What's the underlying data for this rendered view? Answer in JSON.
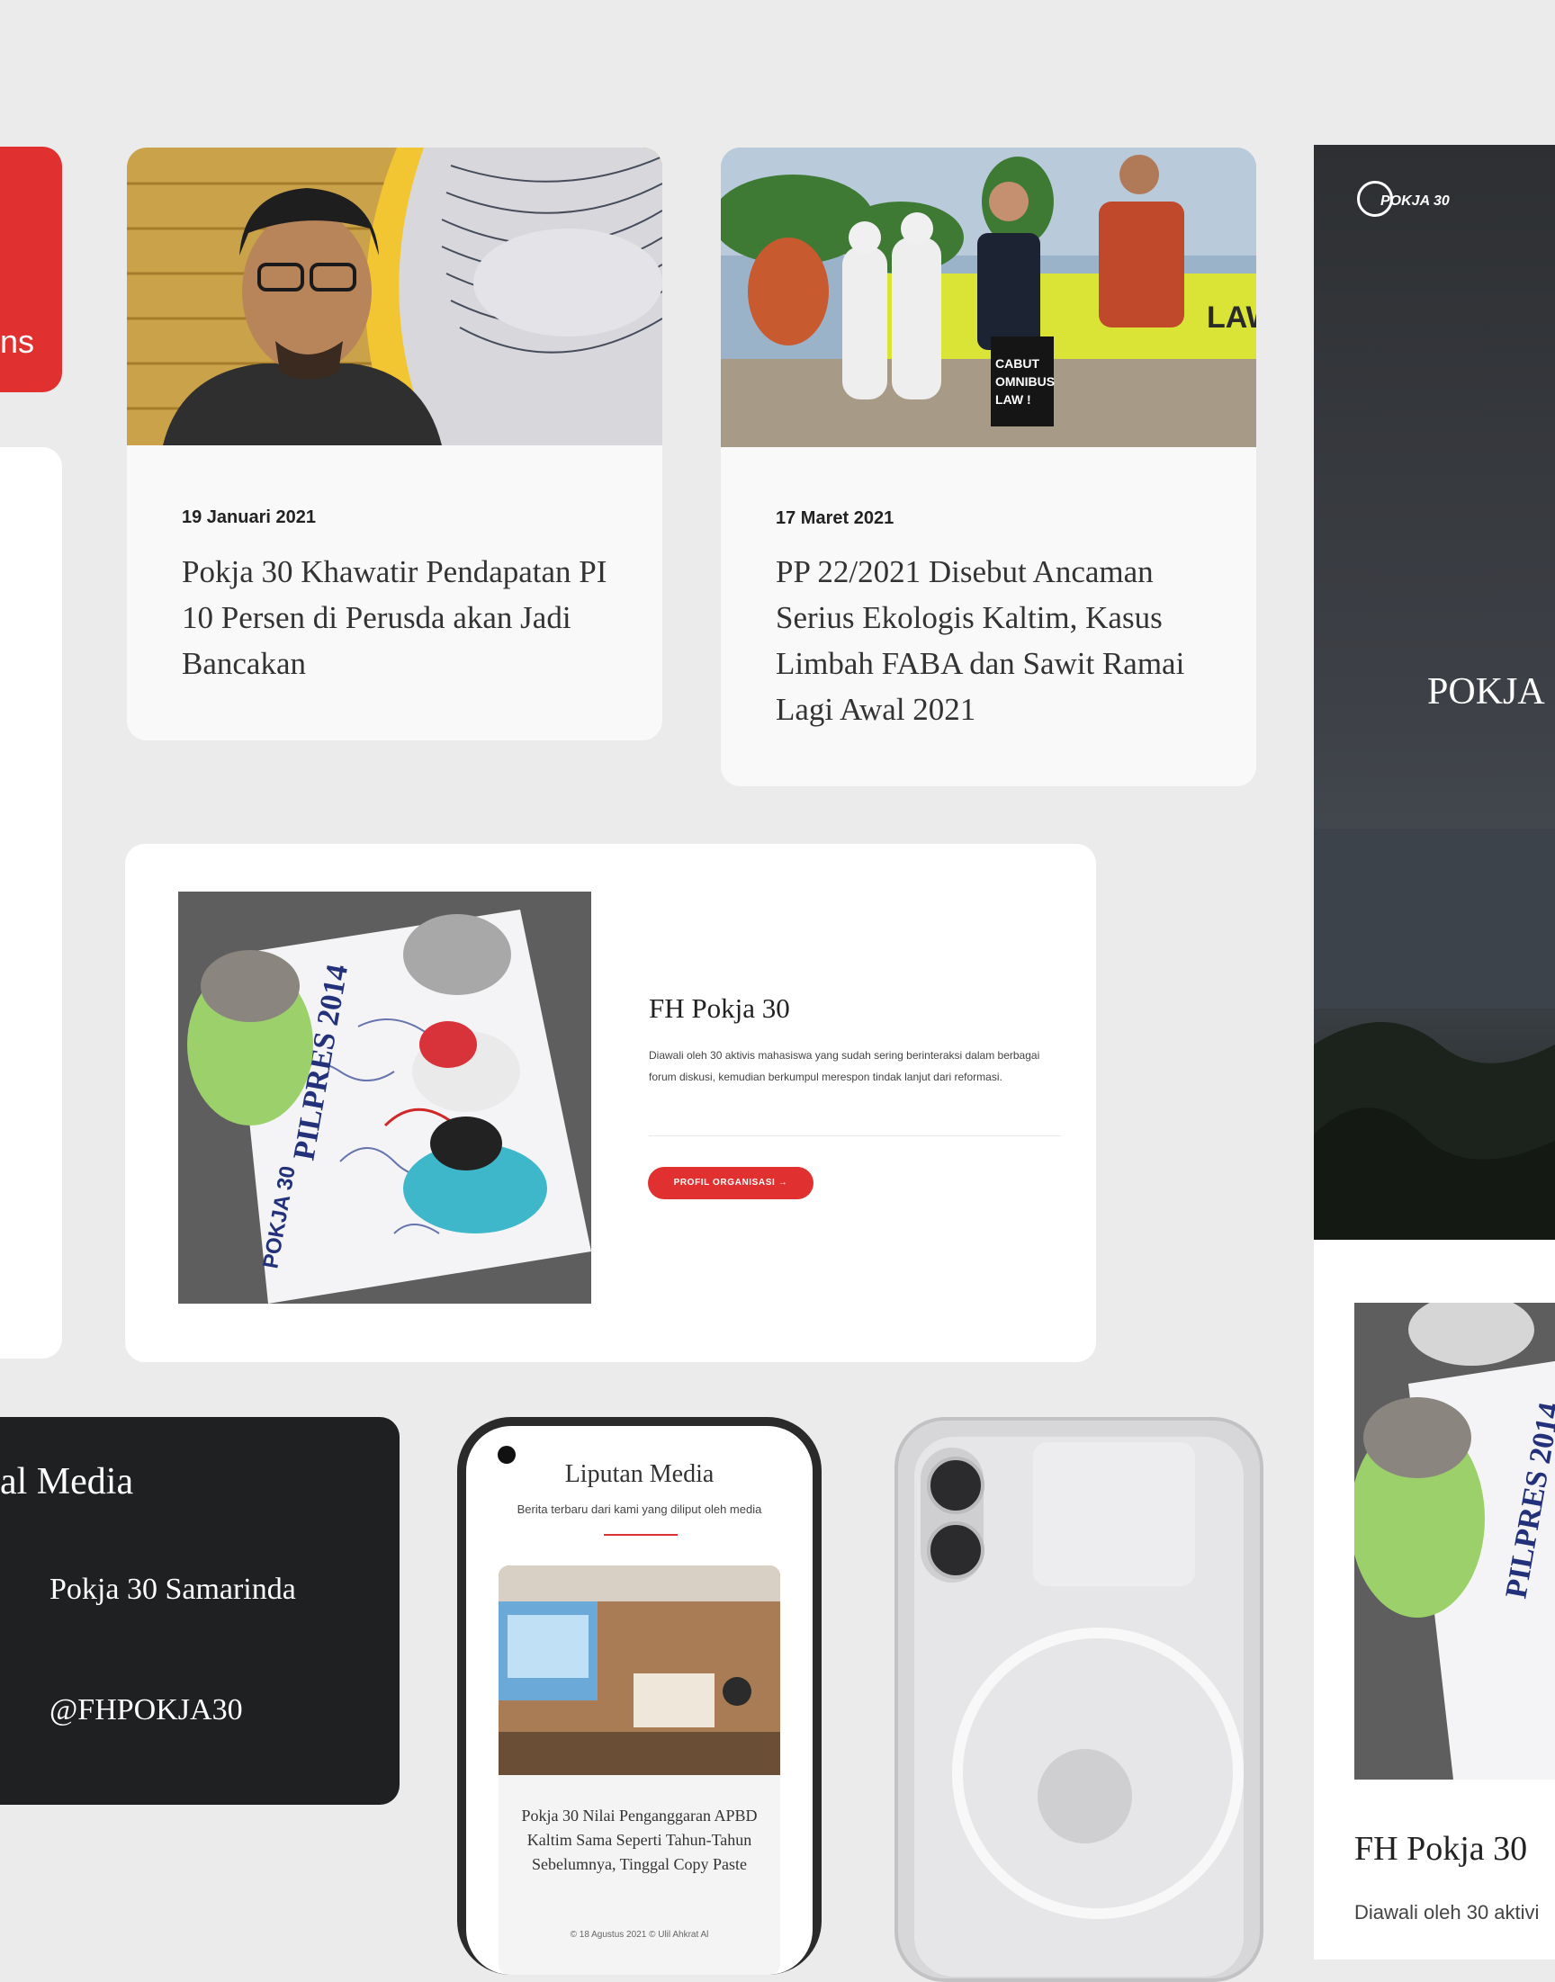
{
  "red_tile": {
    "text": "ns"
  },
  "news": [
    {
      "date": "19 Januari 2021",
      "title": "Pokja 30 Khawatir Pendapatan PI 10 Persen di Perusda akan Jadi Bancakan"
    },
    {
      "date": "17 Maret 2021",
      "title": "PP 22/2021 Disebut Ancaman Serius Ekologis Kaltim, Kasus Limbah FABA dan Sawit Ramai Lagi Awal 2021",
      "photo_sign": "CABUT OMNIBUS LAW !",
      "banner": "LAW"
    }
  ],
  "feature": {
    "title": "FH Pokja 30",
    "description": "Diawali oleh 30 aktivis mahasiswa yang sudah sering berinteraksi dalam berbagai forum diskusi, kemudian berkumpul merespon tindak lanjut dari reformasi.",
    "button_label": "PROFIL ORGANISASI",
    "photo_banner": "PILPRES 2014",
    "photo_logo": "POKJA 30"
  },
  "social": {
    "heading": "al Media",
    "items": [
      "Pokja 30 Samarinda",
      "@FHPOKJA30"
    ]
  },
  "phone": {
    "title": "Liputan Media",
    "subtitle": "Berita terbaru dari kami yang diliput oleh media",
    "article_title": "Pokja 30 Nilai Penganggaran APBD Kaltim Sama Seperti Tahun-Tahun Sebelumnya, Tinggal Copy Paste",
    "meta": "© 18 Agustus 2021  © Ulil Ahkrat Al"
  },
  "hero": {
    "logo_text": "POKJA 30",
    "title": "POKJA"
  },
  "hero_lower": {
    "title": "FH Pokja 30",
    "text": "Diawali oleh 30 aktivi"
  },
  "colors": {
    "accent": "#e03030",
    "background": "#ebebeb",
    "dark": "#1f2022"
  }
}
